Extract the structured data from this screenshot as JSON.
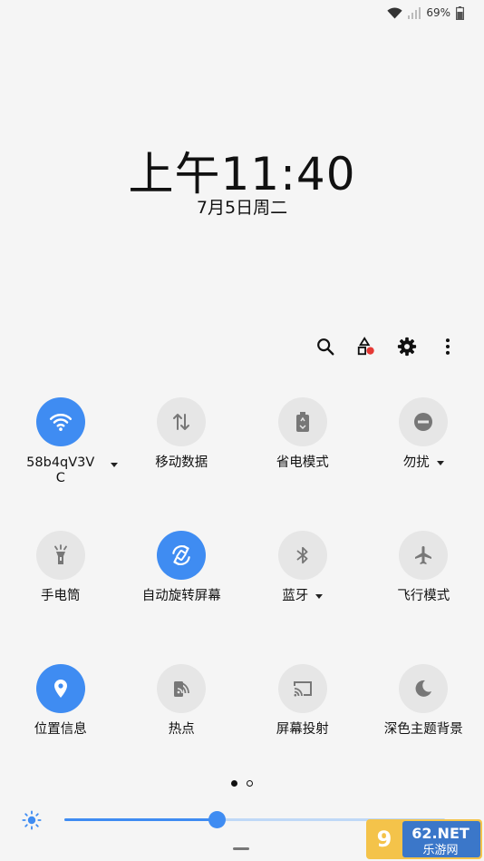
{
  "status_bar": {
    "battery": "69%"
  },
  "clock": {
    "time": "上午11:40",
    "date": "7月5日周二"
  },
  "toolbar": [
    "search-icon",
    "shapes-icon",
    "gear-icon",
    "more-vertical-icon"
  ],
  "tiles": [
    {
      "label": "58b4qV3VC",
      "icon": "wifi-icon",
      "on": true,
      "caret": true
    },
    {
      "label": "移动数据",
      "icon": "mobile-data-icon",
      "on": false,
      "caret": false
    },
    {
      "label": "省电模式",
      "icon": "power-saving-icon",
      "on": false,
      "caret": false
    },
    {
      "label": "勿扰",
      "icon": "do-not-disturb-icon",
      "on": false,
      "caret": true
    },
    {
      "label": "手电筒",
      "icon": "flashlight-icon",
      "on": false,
      "caret": false
    },
    {
      "label": "自动旋转屏幕",
      "icon": "auto-rotate-icon",
      "on": true,
      "caret": false
    },
    {
      "label": "蓝牙",
      "icon": "bluetooth-icon",
      "on": false,
      "caret": true
    },
    {
      "label": "飞行模式",
      "icon": "airplane-icon",
      "on": false,
      "caret": false
    },
    {
      "label": "位置信息",
      "icon": "location-icon",
      "on": true,
      "caret": false
    },
    {
      "label": "热点",
      "icon": "hotspot-icon",
      "on": false,
      "caret": false
    },
    {
      "label": "屏幕投射",
      "icon": "screen-cast-icon",
      "on": false,
      "caret": false
    },
    {
      "label": "深色主题背景",
      "icon": "dark-mode-icon",
      "on": false,
      "caret": false
    }
  ],
  "pager": {
    "pages": 2,
    "current": 1
  },
  "brightness": {
    "level": 0.4
  },
  "watermark": {
    "site": "962.NET",
    "text": "乐游网"
  },
  "colors": {
    "accent": "#3f8cf2",
    "tile_off": "#e6e6e6",
    "background": "#f5f5f5"
  }
}
